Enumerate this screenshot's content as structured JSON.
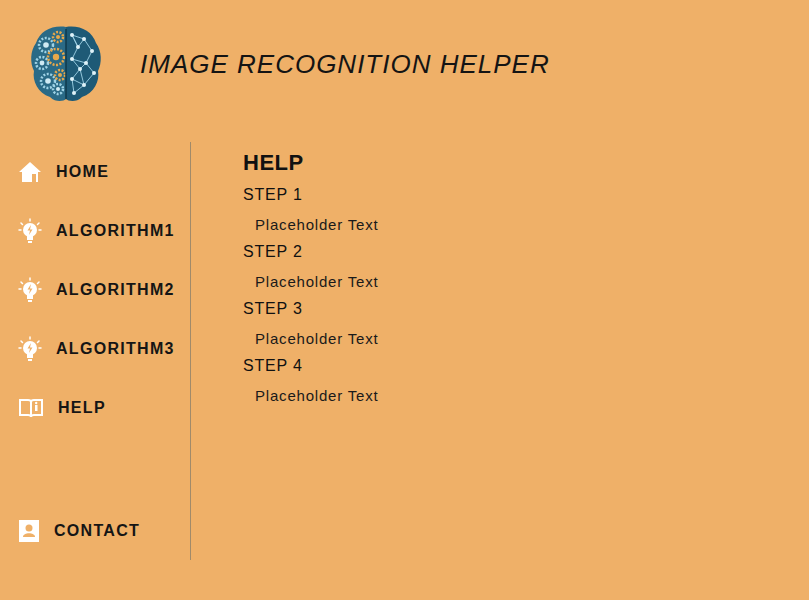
{
  "header": {
    "title": "IMAGE RECOGNITION HELPER"
  },
  "sidebar": {
    "items": [
      {
        "label": "HOME",
        "kind": "home"
      },
      {
        "label": "ALGORITHM1",
        "kind": "bulb"
      },
      {
        "label": "ALGORITHM2",
        "kind": "bulb"
      },
      {
        "label": "ALGORITHM3",
        "kind": "bulb"
      },
      {
        "label": "HELP",
        "kind": "book"
      }
    ],
    "footer_item": {
      "label": "CONTACT",
      "kind": "contact"
    }
  },
  "content": {
    "title": "HELP",
    "steps": [
      {
        "title": "STEP 1",
        "text": "Placeholder Text"
      },
      {
        "title": "STEP 2",
        "text": "Placeholder Text"
      },
      {
        "title": "STEP 3",
        "text": "Placeholder Text"
      },
      {
        "title": "STEP 4",
        "text": "Placeholder Text"
      }
    ]
  }
}
